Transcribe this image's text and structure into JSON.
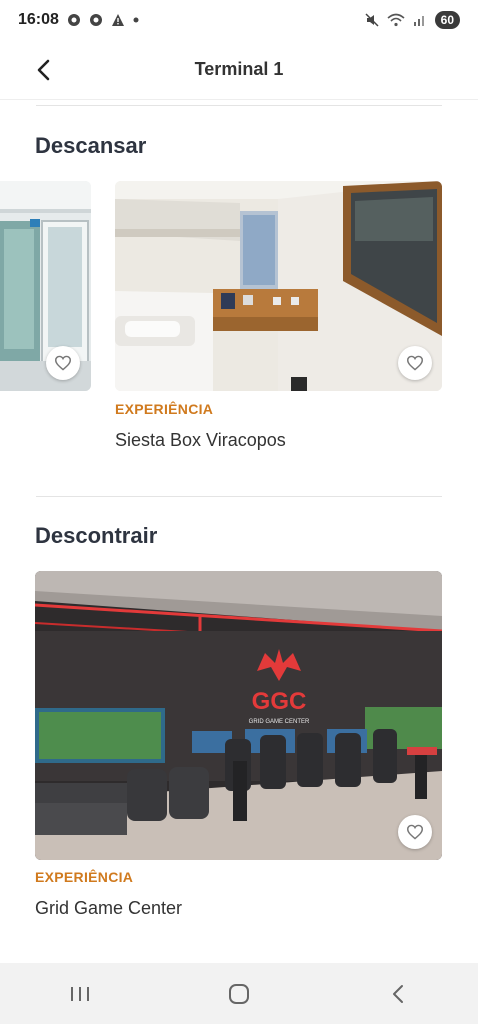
{
  "status_bar": {
    "time": "16:08",
    "battery": "60",
    "notification_icons": [
      "chrome-icon",
      "chrome-icon",
      "warning-icon",
      "dot-icon"
    ],
    "system_icons": [
      "mute-icon",
      "wifi-icon",
      "signal-icon"
    ]
  },
  "header": {
    "title": "Terminal 1",
    "back_icon": "chevron-left-icon"
  },
  "sections": [
    {
      "title": "Descansar",
      "cards": [
        {
          "tag": "",
          "name": ""
        },
        {
          "tag": "EXPERIÊNCIA",
          "name": "Siesta Box Viracopos"
        }
      ]
    },
    {
      "title": "Descontrair",
      "cards": [
        {
          "tag": "EXPERIÊNCIA",
          "name": "Grid Game Center"
        }
      ]
    }
  ],
  "ggc_logo": {
    "letters": "GGC",
    "subtitle": "GRID GAME CENTER"
  },
  "nav_bar": {
    "icons": [
      "recent-apps-icon",
      "home-icon",
      "back-icon"
    ]
  },
  "colors": {
    "accent": "#d07a1e",
    "text": "#2e3440",
    "nav_bg": "#f2f2f2"
  }
}
